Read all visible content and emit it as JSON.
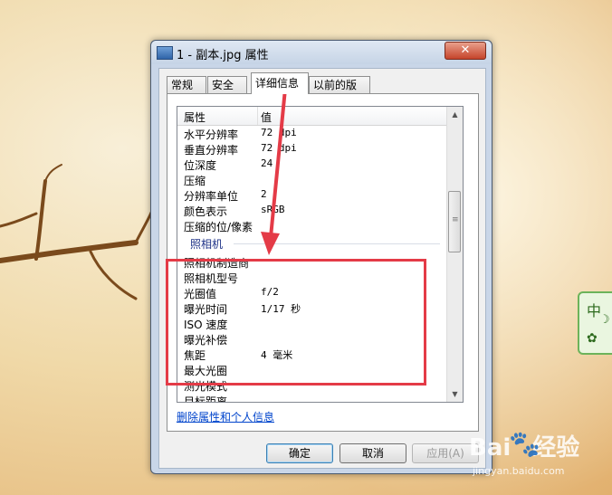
{
  "window": {
    "title": "1 - 副本.jpg 属性",
    "close_symbol": "✕"
  },
  "tabs": [
    {
      "label": "常规",
      "active": false
    },
    {
      "label": "安全",
      "active": false
    },
    {
      "label": "详细信息",
      "active": true
    },
    {
      "label": "以前的版本",
      "active": false
    }
  ],
  "list": {
    "header_property": "属性",
    "header_value": "值",
    "rows": [
      {
        "key": "水平分辨率",
        "value": "72 dpi"
      },
      {
        "key": "垂直分辨率",
        "value": "72 dpi"
      },
      {
        "key": "位深度",
        "value": "24"
      },
      {
        "key": "压缩",
        "value": ""
      },
      {
        "key": "分辨率单位",
        "value": "2"
      },
      {
        "key": "颜色表示",
        "value": "sRGB"
      },
      {
        "key": "压缩的位/像素",
        "value": ""
      }
    ],
    "group_camera": "照相机",
    "camera_rows": [
      {
        "key": "照相机制造商",
        "value": ""
      },
      {
        "key": "照相机型号",
        "value": ""
      },
      {
        "key": "光圈值",
        "value": "f/2"
      },
      {
        "key": "曝光时间",
        "value": "1/17 秒"
      },
      {
        "key": "ISO 速度",
        "value": ""
      },
      {
        "key": "曝光补偿",
        "value": ""
      },
      {
        "key": "焦距",
        "value": "4 毫米"
      },
      {
        "key": "最大光圈",
        "value": ""
      },
      {
        "key": "测光模式",
        "value": ""
      },
      {
        "key": "目标距离",
        "value": ""
      }
    ]
  },
  "link_remove": "删除属性和个人信息",
  "buttons": {
    "ok": "确定",
    "cancel": "取消",
    "apply": "应用(A)"
  },
  "ime": {
    "mode": "中",
    "moon": "☽",
    "gear": "✿"
  },
  "watermark": {
    "logo": "Bai",
    "suffix": "经验",
    "paw": "🐾",
    "url": "jingyan.baidu.com"
  },
  "annotation_color": "#e43b47"
}
